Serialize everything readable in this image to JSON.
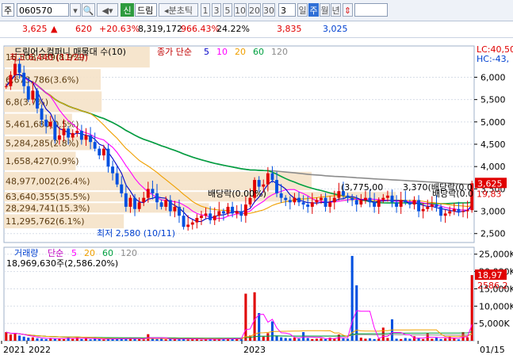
{
  "toolbar": {
    "market": "주",
    "code": "060570",
    "new_button": "신",
    "name": "드림",
    "period_label": "분초틱",
    "intervals": [
      "1",
      "3",
      "5",
      "10",
      "20",
      "30"
    ],
    "count": "3",
    "day": "일",
    "week": "주",
    "month": "월",
    "year": "년"
  },
  "quote": {
    "price": "3,625",
    "change": "620",
    "change_pct": "+20.63%",
    "volume": "8,319,172",
    "volume_ratio": "966.43%",
    "turnover": "24.22%",
    "high": "3,835",
    "low": "3,025"
  },
  "colors": {
    "up": "#e00000",
    "down": "#0050e0",
    "ma5": "#0000c8",
    "ma10": "#ff00ff",
    "ma20": "#f0a000",
    "ma60": "#00a040",
    "ma120": "#8c8c8c"
  },
  "chart_data": [
    {
      "type": "candlestick",
      "title": "드림어스컴퍼니 매물대 수(10)",
      "legend_label": "종가 단순",
      "ma_periods": [
        "5",
        "10",
        "20",
        "60",
        "120"
      ],
      "ylim": [
        2300,
        6700
      ],
      "yticks": [
        "6,000",
        "5,500",
        "5,000",
        "4,500",
        "4,000",
        "3,500",
        "3,000",
        "2,500"
      ],
      "ytick_values": [
        6000,
        5500,
        5000,
        4500,
        4000,
        3500,
        3000,
        2500
      ],
      "corner_labels": [
        "LC:40,50",
        "HC:-43,"
      ],
      "x_labels": [
        "2021",
        "2022",
        "2023",
        "01/15"
      ],
      "current_price": "3,625",
      "prev_close_label": "19,83",
      "high_marker": "최고 6,440 (11/29)",
      "low_marker": "최저 2,580 (10/11)",
      "dividend_labels": [
        "배당락(0.00%)",
        "배당락(0.0"
      ],
      "volume_profile": [
        {
          "price_low": 6200,
          "price_high": 6700,
          "label": "16,508,339(8.9%)"
        },
        {
          "price_low": 5700,
          "price_high": 6200,
          "label": "6,673,786(3.6%)"
        },
        {
          "price_low": 5200,
          "price_high": 5700,
          "label": "6,8(3.7%)"
        },
        {
          "price_low": 4700,
          "price_high": 5200,
          "label": "5,461,680(0.5%)"
        },
        {
          "price_low": 4350,
          "price_high": 4700,
          "label": "5,284,285(2.8%)"
        },
        {
          "price_low": 3900,
          "price_high": 4350,
          "label": "1,658,427(0.9%)"
        },
        {
          "price_low": 3450,
          "price_high": 3900,
          "label": "48,977,002(26.4%)"
        },
        {
          "price_low": 3200,
          "price_high": 3450,
          "label": "63,640,355(35.5%)"
        },
        {
          "price_low": 2950,
          "price_high": 3200,
          "label": "28,294,741(15.3%)"
        },
        {
          "price_low": 2600,
          "price_high": 2950,
          "label": "11,295,762(6.1%)"
        }
      ],
      "extra_labels": [
        "(3,775,00",
        "3,370(배당락(0.0"
      ],
      "closes": [
        5800,
        6050,
        6300,
        6100,
        5800,
        5500,
        5700,
        5300,
        5050,
        4900,
        5000,
        4600,
        4700,
        4850,
        4650,
        4750,
        4800,
        4600,
        4700,
        4550,
        4400,
        4250,
        4400,
        4000,
        3850,
        3600,
        3400,
        3100,
        3300,
        3050,
        3200,
        3300,
        3500,
        3400,
        3200,
        3100,
        3250,
        3000,
        3100,
        2900,
        2650,
        2700,
        2750,
        2850,
        2900,
        2950,
        2800,
        2900,
        3000,
        2950,
        3100,
        2950,
        3000,
        2900,
        3150,
        3300,
        3700,
        3550,
        3600,
        3850,
        3700,
        3400,
        3300,
        3250,
        3200,
        3300,
        3200,
        3150,
        3100,
        3200,
        3250,
        3300,
        3100,
        3200,
        3300,
        3450,
        3350,
        3300,
        3250,
        3150,
        3250,
        3300,
        3200,
        3100,
        3250,
        3300,
        3350,
        3200,
        3100,
        3250,
        3200,
        3150,
        3250,
        3000,
        3050,
        3100,
        3150,
        3100,
        2900,
        2950,
        3000,
        3050,
        3000,
        3000,
        3025,
        3625
      ]
    },
    {
      "type": "bar",
      "title": "거래량",
      "legend_label": "단순",
      "ma_periods": [
        "5",
        "20",
        "60",
        "120"
      ],
      "value_label": "18,969,630주(2,586.20%)",
      "ylim": [
        0,
        27000
      ],
      "yticks": [
        "25,000K",
        "20,000K",
        "15,000K",
        "10,000K",
        "5,000K"
      ],
      "ytick_values": [
        25000,
        20000,
        15000,
        10000,
        5000
      ],
      "current_labels": [
        "18,97",
        "2586.2"
      ],
      "volumes": [
        2500,
        1800,
        2200,
        1500,
        1200,
        900,
        1000,
        700,
        600,
        500,
        800,
        600,
        700,
        500,
        900,
        600,
        1100,
        500,
        700,
        400,
        600,
        500,
        400,
        700,
        500,
        600,
        700,
        500,
        800,
        600,
        500,
        400,
        1900,
        700,
        500,
        600,
        400,
        500,
        600,
        500,
        700,
        400,
        600,
        500,
        300,
        400,
        600,
        500,
        400,
        700,
        500,
        600,
        800,
        600,
        13600,
        1500,
        14000,
        8000,
        1200,
        2200,
        5600,
        1500,
        1000,
        800,
        700,
        900,
        600,
        2500,
        800,
        500,
        600,
        700,
        500,
        900,
        600,
        1800,
        700,
        600,
        24500,
        16000,
        900,
        600,
        700,
        500,
        600,
        3800,
        800,
        6200,
        600,
        500,
        800,
        600,
        1300,
        700,
        500,
        2100,
        600,
        900,
        500,
        700,
        1200,
        700,
        400,
        2500,
        1000,
        18970
      ]
    }
  ]
}
